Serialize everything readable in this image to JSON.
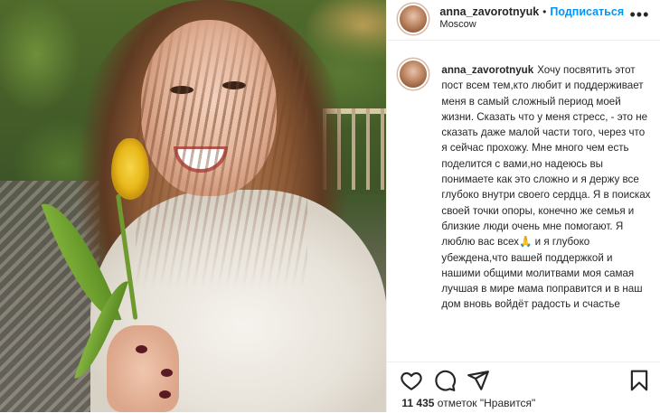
{
  "post": {
    "username": "anna_zavorotnyuk",
    "follow_label": "Подписаться",
    "separator": "•",
    "location": "Moscow",
    "more_label": "•••"
  },
  "caption": {
    "username": "anna_zavorotnyuk",
    "text": "Хочу посвятить этот пост всем тем,кто любит и поддерживает меня в самый сложный период моей жизни. Сказать что у меня стресс, - это не сказать даже малой части того, через что я сейчас прохожу. Мне много чем есть поделится с вами,но надеюсь вы понимаете как это сложно и я держу все глубоко внутри своего сердца. Я в поисках своей точки опоры, конечно же семья и близкие люди очень мне помогают. Я люблю вас всех🙏 и я глубоко убеждена,что вашей поддержкой и нашими общими молитвами моя самая лучшая в мире мама поправится и в наш дом вновь войдёт радость и счастье"
  },
  "actions": {
    "likes_count": "11 435",
    "likes_text": "отметок \"Нравится\""
  },
  "icons": [
    "heart-icon",
    "comment-icon",
    "share-icon",
    "bookmark-icon",
    "more-icon"
  ],
  "colors": {
    "accent": "#0095f6",
    "text": "#262626",
    "border": "#efefef"
  }
}
